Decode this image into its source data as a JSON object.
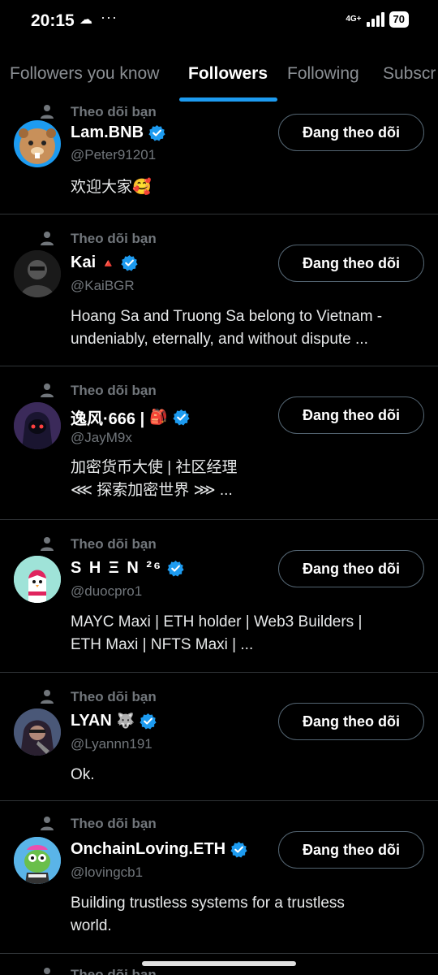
{
  "status_bar": {
    "time": "20:15",
    "network": "4G+",
    "battery": "70",
    "cloud_icon": "cloud-icon",
    "more_icon": "ellipsis-icon"
  },
  "tabs": [
    {
      "label": "Followers you know"
    },
    {
      "label": "Followers",
      "active": true
    },
    {
      "label": "Following"
    },
    {
      "label": "Subscr"
    }
  ],
  "follows_label_top": "Theo dõi bạn",
  "follows_label": "Theo dõi bạn",
  "button_label": "Đang theo dõi",
  "users": [
    {
      "name": "Lam.BNB",
      "handle": "@Peter91201",
      "bio_lines": [
        "欢迎大家🥰"
      ],
      "verified": true
    },
    {
      "name": "Kai",
      "name_suffix": "🔺",
      "handle": "@KaiBGR",
      "bio_lines": [
        "Hoang Sa and Truong Sa belong to Vietnam -",
        "undeniably, eternally, and without dispute ..."
      ],
      "verified": true
    },
    {
      "name": "逸风·666 |",
      "name_suffix": "🎒",
      "handle": "@JayM9x",
      "bio_lines": [
        "加密货币大使 | 社区经理",
        "⋘ 探索加密世界 ⋙ ..."
      ],
      "verified": true
    },
    {
      "name": "S H Ξ N ²⁶",
      "handle": "@duocpro1",
      "bio_lines": [
        "MAYC Maxi | ETH holder | Web3 Builders |",
        "ETH Maxi |  NFTS Maxi | ..."
      ],
      "verified": true
    },
    {
      "name": "LYAN",
      "name_suffix": "🐺",
      "handle": "@Lyannn191",
      "bio_lines": [
        "Ok."
      ],
      "verified": true
    },
    {
      "name": "OnchainLoving.ETH",
      "handle": "@lovingcb1",
      "bio_lines": [
        "Building trustless systems for a trustless",
        "world."
      ],
      "verified": true
    }
  ],
  "colors": {
    "accent": "#1d9bf0",
    "background": "#000000",
    "muted": "#71767b",
    "divider": "#2f3336"
  }
}
